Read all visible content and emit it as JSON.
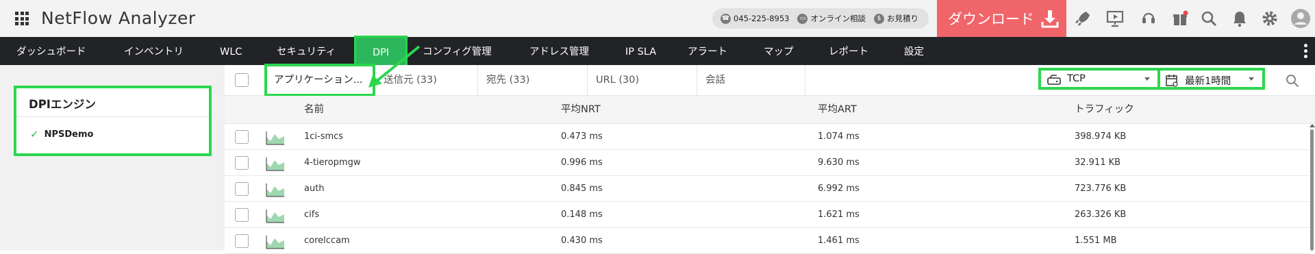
{
  "header": {
    "app_title": "NetFlow Analyzer",
    "phone": "045-225-8953",
    "consult": "オンライン相談",
    "estimate": "お見積り",
    "download_label": "ダウンロード",
    "accent_color": "#f0656a",
    "icons": [
      "rocket-icon",
      "presentation-icon",
      "headset-icon",
      "gift-icon",
      "search-icon",
      "bell-icon",
      "gear-icon",
      "user-avatar-icon"
    ]
  },
  "nav": {
    "items": [
      "ダッシュボード",
      "インベントリ",
      "WLC",
      "セキュリティ",
      "DPI",
      "コンフィグ管理",
      "アドレス管理",
      "IP SLA",
      "アラート",
      "マップ",
      "レポート",
      "設定"
    ],
    "active": "DPI",
    "active_color": "#2db75c"
  },
  "left_panel": {
    "card_title": "DPIエンジン",
    "engine": "NPSDemo"
  },
  "tabs": {
    "items": [
      "アプリケーション...",
      "送信元 (33)",
      "宛先 (33)",
      "URL (30)",
      "会話"
    ],
    "active": "アプリケーション..."
  },
  "filters": {
    "protocol": "TCP",
    "time_range": "最新1時間"
  },
  "table": {
    "columns": [
      "名前",
      "平均NRT",
      "平均ART",
      "トラフィック"
    ],
    "rows": [
      {
        "name": "1ci-smcs",
        "nrt": "0.473 ms",
        "art": "1.074 ms",
        "traffic": "398.974 KB"
      },
      {
        "name": "4-tieropmgw",
        "nrt": "0.996 ms",
        "art": "9.630 ms",
        "traffic": "32.911 KB"
      },
      {
        "name": "auth",
        "nrt": "0.845 ms",
        "art": "6.992 ms",
        "traffic": "723.776 KB"
      },
      {
        "name": "cifs",
        "nrt": "0.148 ms",
        "art": "1.621 ms",
        "traffic": "263.326 KB"
      },
      {
        "name": "corelccam",
        "nrt": "0.430 ms",
        "art": "1.461 ms",
        "traffic": "1.551 MB"
      }
    ]
  },
  "highlight_color": "#2bd64e"
}
